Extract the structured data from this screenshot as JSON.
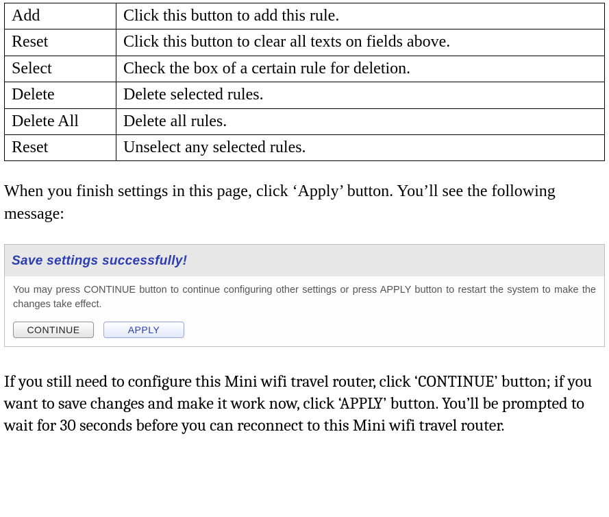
{
  "table": {
    "rows": [
      {
        "term": "Add",
        "desc": "Click this button to add this rule."
      },
      {
        "term": "Reset",
        "desc": "Click this button to clear all texts on fields above."
      },
      {
        "term": "Select",
        "desc": "Check the box of a certain rule for deletion."
      },
      {
        "term": "Delete",
        "desc": "Delete selected rules."
      },
      {
        "term": "Delete All",
        "desc": "Delete all rules."
      },
      {
        "term": "Reset",
        "desc": "Unselect any selected rules."
      }
    ]
  },
  "para1": "When you finish settings in this page, click ‘Apply’ button. You’ll see the following message:",
  "panel": {
    "title": "Save settings successfully!",
    "message": "You may press CONTINUE button to continue configuring other settings or press APPLY button to restart the system to make the changes take effect.",
    "continue_label": "CONTINUE",
    "apply_label": "APPLY"
  },
  "para2": "If you still need to configure this Mini wifi travel router, click ‘CONTINUE’ button; if you want to save changes and make it work now, click ‘APPLY’ button. You’ll be prompted to wait for 30 seconds before you can reconnect to this Mini wifi travel router."
}
